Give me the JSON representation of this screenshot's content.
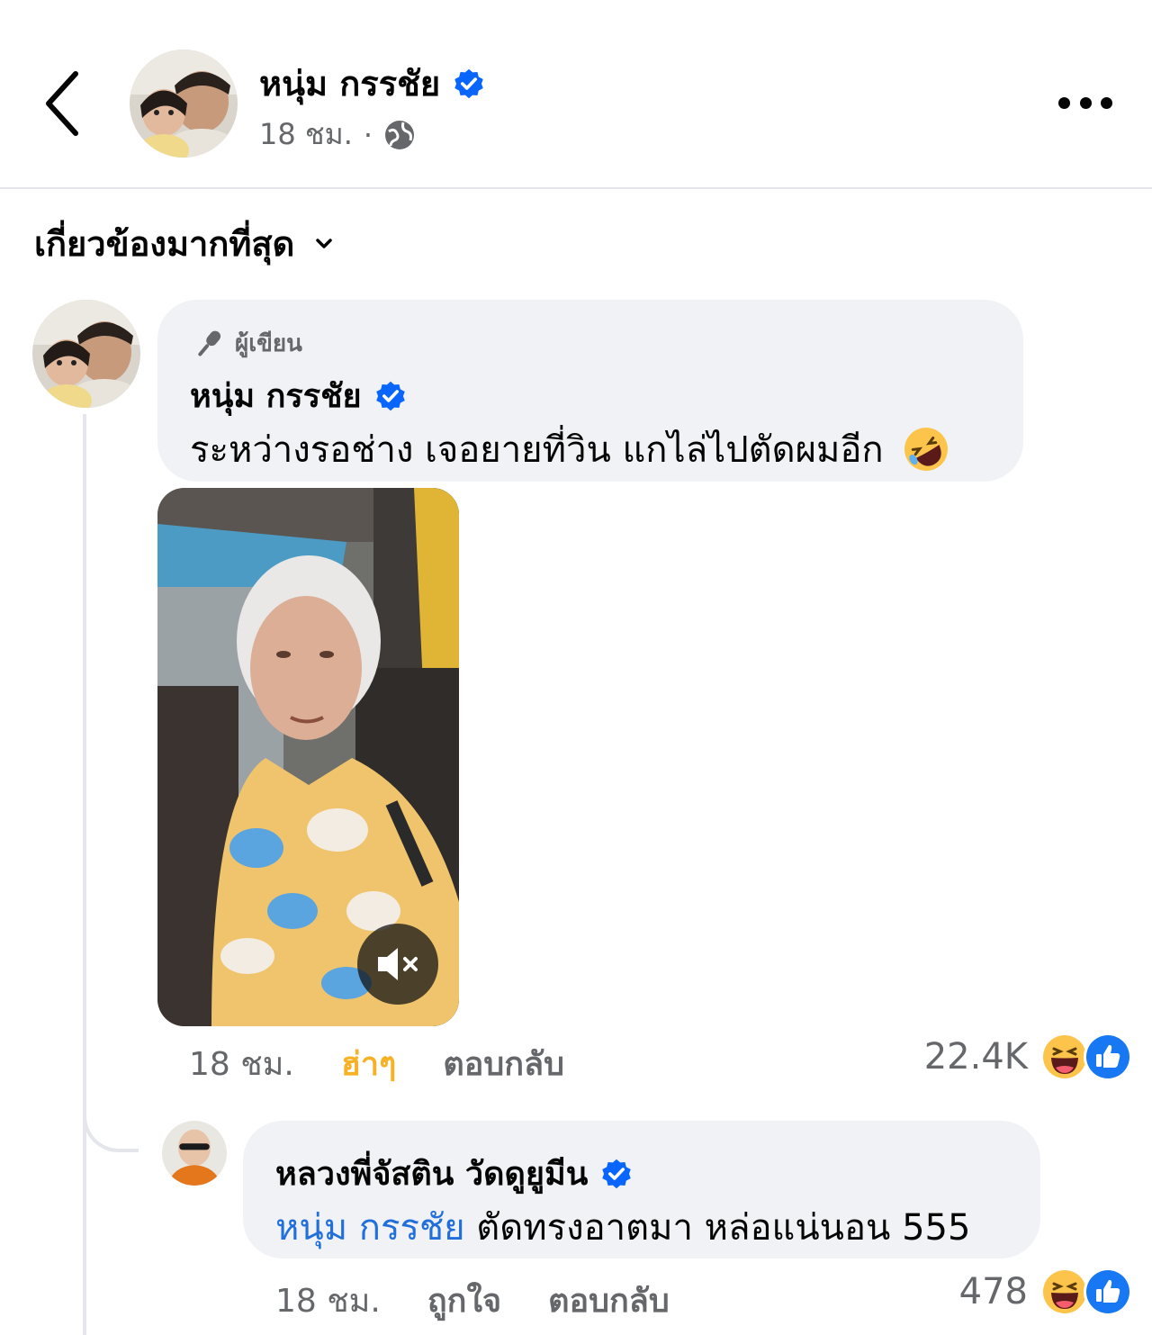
{
  "header": {
    "name": "หนุ่ม กรรชัย",
    "time": "18 ชม.",
    "separator": "·",
    "icons": {
      "back": "chevron-left-icon",
      "verified": "verified-badge-icon",
      "privacy": "globe-icon",
      "more": "more-horizontal-icon"
    }
  },
  "sort": {
    "label": "เกี่ยวข้องมากที่สุด",
    "icon": "chevron-down-icon"
  },
  "comments": [
    {
      "badge": "ผู้เขียน",
      "badge_icon": "microphone-icon",
      "name": "หนุ่ม กรรชัย",
      "text": "ระหว่างรอช่าง เจอยายที่วิน แกไล่ไปตัดผมอีก",
      "emoji": "rolling-on-floor-laughing-emoji",
      "media": {
        "type": "video",
        "mute_icon": "volume-muted-icon"
      },
      "time": "18 ชม.",
      "reaction_label": "ฮ่าๆ",
      "reply_label": "ตอบกลับ",
      "reaction_count": "22.4K",
      "reaction_icons": [
        "haha-icon",
        "like-icon"
      ]
    },
    {
      "name": "หลวงพี่จัสติน วัดดูยูมีน",
      "mention": "หนุ่ม กรรชัย",
      "text": "ตัดทรงอาตมา หล่อแน่นอน 555",
      "time": "18 ชม.",
      "like_label": "ถูกใจ",
      "reply_label": "ตอบกลับ",
      "reaction_count": "478",
      "reaction_icons": [
        "haha-icon",
        "like-icon"
      ]
    }
  ],
  "colors": {
    "accent": "#0866ff",
    "mention": "#216fdb",
    "haha_label": "#f7b125",
    "muted": "#65676b",
    "bubble": "#f0f2f5"
  }
}
